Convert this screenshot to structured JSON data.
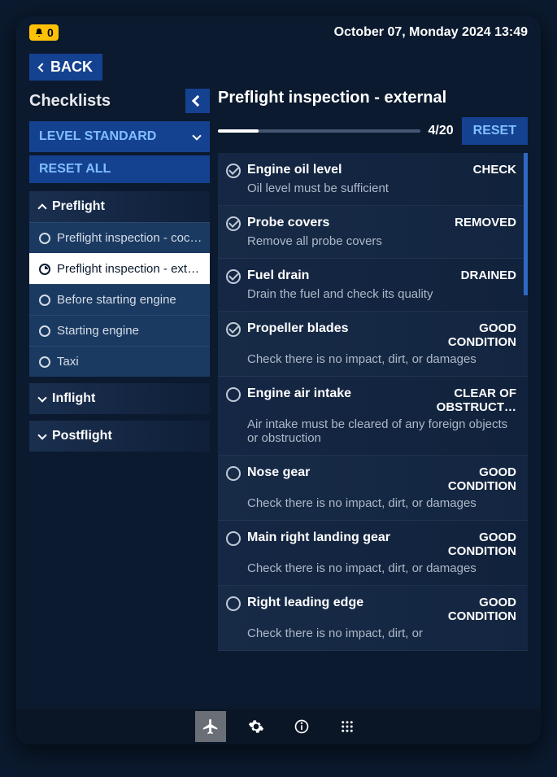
{
  "status": {
    "alert_count": "0",
    "datetime": "October 07, Monday 2024 13:49"
  },
  "back_label": "BACK",
  "sidebar": {
    "title": "Checklists",
    "level_label": "LEVEL STANDARD",
    "reset_all_label": "RESET ALL",
    "groups": [
      {
        "name": "Preflight",
        "expanded": true,
        "items": [
          {
            "label": "Preflight inspection - coc…",
            "state": "empty",
            "active": false
          },
          {
            "label": "Preflight inspection - ext…",
            "state": "partial",
            "active": true
          },
          {
            "label": "Before starting engine",
            "state": "empty",
            "active": false
          },
          {
            "label": "Starting engine",
            "state": "empty",
            "active": false
          },
          {
            "label": "Taxi",
            "state": "empty",
            "active": false
          }
        ]
      },
      {
        "name": "Inflight",
        "expanded": false
      },
      {
        "name": "Postflight",
        "expanded": false
      }
    ]
  },
  "content": {
    "title": "Preflight inspection - external",
    "progress_done": 4,
    "progress_total": 20,
    "progress_label": "4/20",
    "reset_label": "RESET",
    "items": [
      {
        "checked": true,
        "name": "Engine oil level",
        "value": "CHECK",
        "desc": "Oil level must be sufficient"
      },
      {
        "checked": true,
        "name": "Probe covers",
        "value": "REMOVED",
        "desc": "Remove all probe covers"
      },
      {
        "checked": true,
        "name": "Fuel drain",
        "value": "DRAINED",
        "desc": "Drain the fuel and check its quality"
      },
      {
        "checked": true,
        "name": "Propeller blades",
        "value": "GOOD CONDITION",
        "desc": "Check there is no impact, dirt, or damages"
      },
      {
        "checked": false,
        "name": "Engine air intake",
        "value": "CLEAR OF OBSTRUCT…",
        "desc": "Air intake must be cleared of any foreign objects or obstruction"
      },
      {
        "checked": false,
        "name": "Nose gear",
        "value": "GOOD CONDITION",
        "desc": "Check there is no impact, dirt, or damages"
      },
      {
        "checked": false,
        "name": "Main right landing gear",
        "value": "GOOD CONDITION",
        "desc": "Check there is no impact, dirt, or damages"
      },
      {
        "checked": false,
        "name": "Right leading edge",
        "value": "GOOD CONDITION",
        "desc": "Check there is no impact, dirt, or"
      }
    ]
  }
}
